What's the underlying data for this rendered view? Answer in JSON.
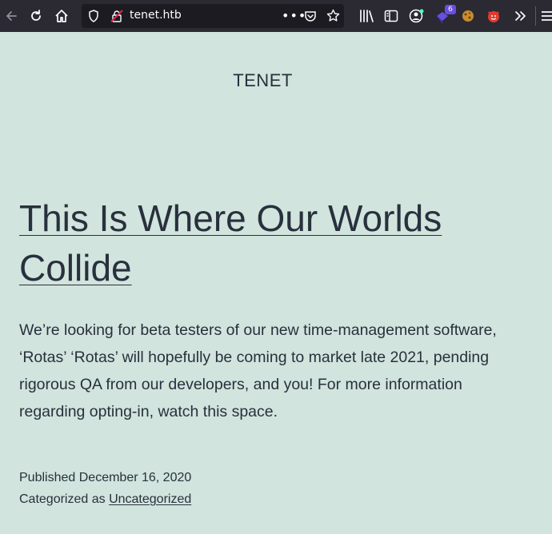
{
  "browser": {
    "url": "tenet.htb",
    "extension_badge_count": "6",
    "colors": {
      "toolbar": "#2b2a33",
      "urlbar": "#1c1b22",
      "icon": "#fbfbfe"
    },
    "icons": [
      "back-arrow-icon",
      "reload-icon",
      "home-icon",
      "shield-icon",
      "insecure-lock-icon",
      "more-dots-icon",
      "pocket-icon",
      "star-icon",
      "library-icon",
      "reader-sidebar-icon",
      "account-icon",
      "extension-icon",
      "cookie-icon",
      "fox-icon",
      "overflow-chevron-icon",
      "menu-icon"
    ]
  },
  "site": {
    "title": "TENET",
    "background": "#d1e4dd",
    "text_color": "#28303d"
  },
  "post": {
    "title": "This Is Where Our Worlds Collide",
    "body": "We’re looking for beta testers of our new time-management software, ‘Rotas’ ‘Rotas’ will hopefully be coming to market late 2021, pending rigorous QA from our developers, and you! For more information regarding opting-in, watch this space.",
    "published_label": "Published",
    "published_date": "December 16, 2020",
    "categorized_label": "Categorized as",
    "category": "Uncategorized"
  }
}
